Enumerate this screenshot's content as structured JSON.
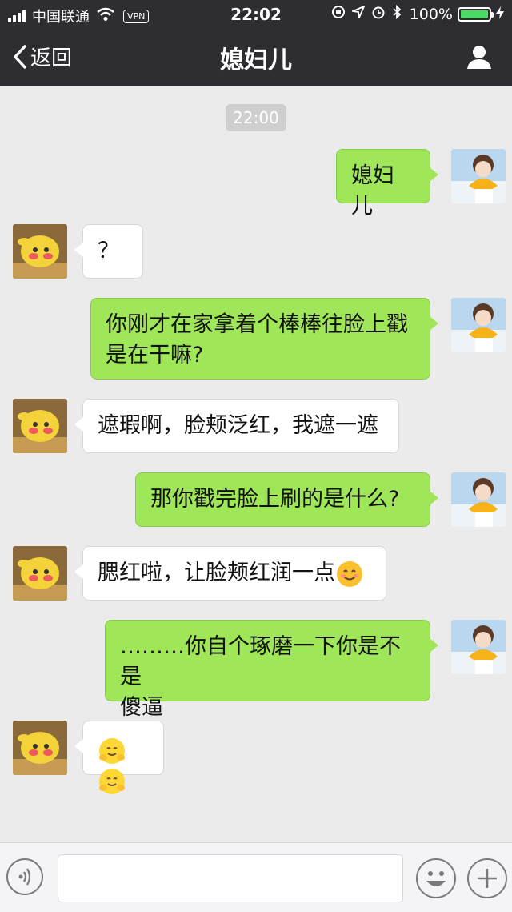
{
  "status_bar": {
    "carrier": "中国联通",
    "vpn": "VPN",
    "time": "22:02",
    "battery": "100%",
    "battery_level": 1.0
  },
  "nav": {
    "back_label": "返回",
    "title": "媳妇儿"
  },
  "chat": {
    "timestamp": "22:00",
    "messages": [
      {
        "from": "me",
        "text": "媳妇儿"
      },
      {
        "from": "her",
        "text": "？"
      },
      {
        "from": "me",
        "lines": [
          "你刚才在家拿着个棒棒往脸上戳",
          "是在干嘛?"
        ]
      },
      {
        "from": "her",
        "text": "遮瑕啊，脸颊泛红，我遮一遮"
      },
      {
        "from": "me",
        "text": "那你戳完脸上刷的是什么?"
      },
      {
        "from": "her",
        "text": "腮红啦，让脸颊红润一点",
        "emoji": "smiling-face-emoji"
      },
      {
        "from": "me",
        "lines": [
          "………你自个琢磨一下你是不是",
          "傻逼"
        ]
      },
      {
        "from": "her",
        "emoji": [
          "hugging-face-emoji",
          "hugging-face-emoji"
        ]
      }
    ]
  },
  "colors": {
    "header_bg": "#2e2e32",
    "chat_bg": "#ebebeb",
    "my_bubble": "#9fe658",
    "her_bubble": "#ffffff",
    "battery_fill": "#4cd964"
  },
  "icons": {
    "back": "chevron-left-icon",
    "profile": "person-icon",
    "voice": "voice-icon",
    "emoji": "emoji-icon",
    "plus": "plus-icon"
  }
}
